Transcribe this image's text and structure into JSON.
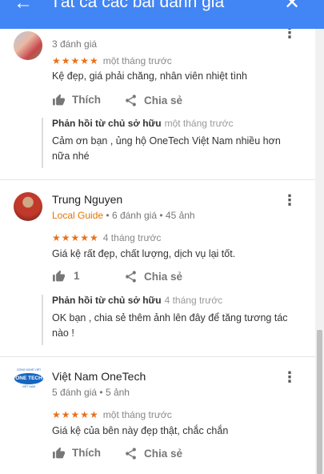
{
  "header": {
    "title": "Tất cả các bài đánh giá",
    "back_icon": "arrow-back-icon",
    "close_icon": "close-icon",
    "color": "#4285f4"
  },
  "reviews": [
    {
      "reviewer_name": "",
      "meta_count": "3 đánh giá",
      "stars": "★★★★★",
      "time": "một tháng trước",
      "text": "Kệ đẹp, giá phải chăng, nhân viên nhiệt tình",
      "like_label": "Thích",
      "share_label": "Chia sẻ",
      "owner_label": "Phản hồi từ chủ sở hữu",
      "owner_time": "một tháng trước",
      "owner_text": "Cảm ơn bạn , ủng hộ OneTech Việt Nam nhiều hơn nữa nhé"
    },
    {
      "reviewer_name": "Trung Nguyen",
      "guide": "Local Guide",
      "meta_count": "6 đánh giá",
      "meta_photos": "45 ảnh",
      "stars": "★★★★★",
      "time": "4 tháng trước",
      "text": "Giá kệ rất đẹp, chất lượng, dịch vụ lại tốt.",
      "like_count": "1",
      "share_label": "Chia sẻ",
      "owner_label": "Phản hồi từ chủ sở hữu",
      "owner_time": "4 tháng trước",
      "owner_text": "OK bạn , chia sẻ thêm ảnh lên đây để tăng tương tác nào !"
    },
    {
      "reviewer_name": "Việt Nam OneTech",
      "meta_count": "5 đánh giá",
      "meta_photos": "5 ảnh",
      "stars": "★★★★★",
      "time": "một tháng trước",
      "text": "Giá kệ của bên này đẹp thật, chắc chắn",
      "like_label": "Thích",
      "share_label": "Chia sẻ",
      "avatar_top": "CÔNG NGHỆ VIỆT",
      "avatar_logo": "ONE TECH",
      "avatar_bottom": "VIỆT NAM"
    }
  ],
  "colors": {
    "star": "#e7711b",
    "local_guide": "#e37400"
  },
  "separator": "•",
  "more_glyph": "⋮"
}
